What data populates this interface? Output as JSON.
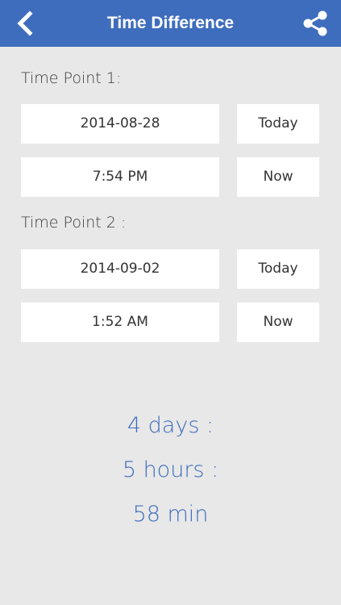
{
  "header": {
    "title": "Time Difference",
    "back_icon": "chevron-left-icon",
    "share_icon": "share-icon",
    "background_color": "#3f6dbd"
  },
  "time_point_1": {
    "label": "Time Point 1:",
    "date": "2014-08-28",
    "date_button": "Today",
    "time": "7:54 PM",
    "time_button": "Now"
  },
  "time_point_2": {
    "label": "Time Point 2 :",
    "date": "2014-09-02",
    "date_button": "Today",
    "time": "1:52 AM",
    "time_button": "Now"
  },
  "result": {
    "days": "4 days :",
    "hours": "5 hours :",
    "minutes": "58 min",
    "color": "#3f6dbd"
  }
}
